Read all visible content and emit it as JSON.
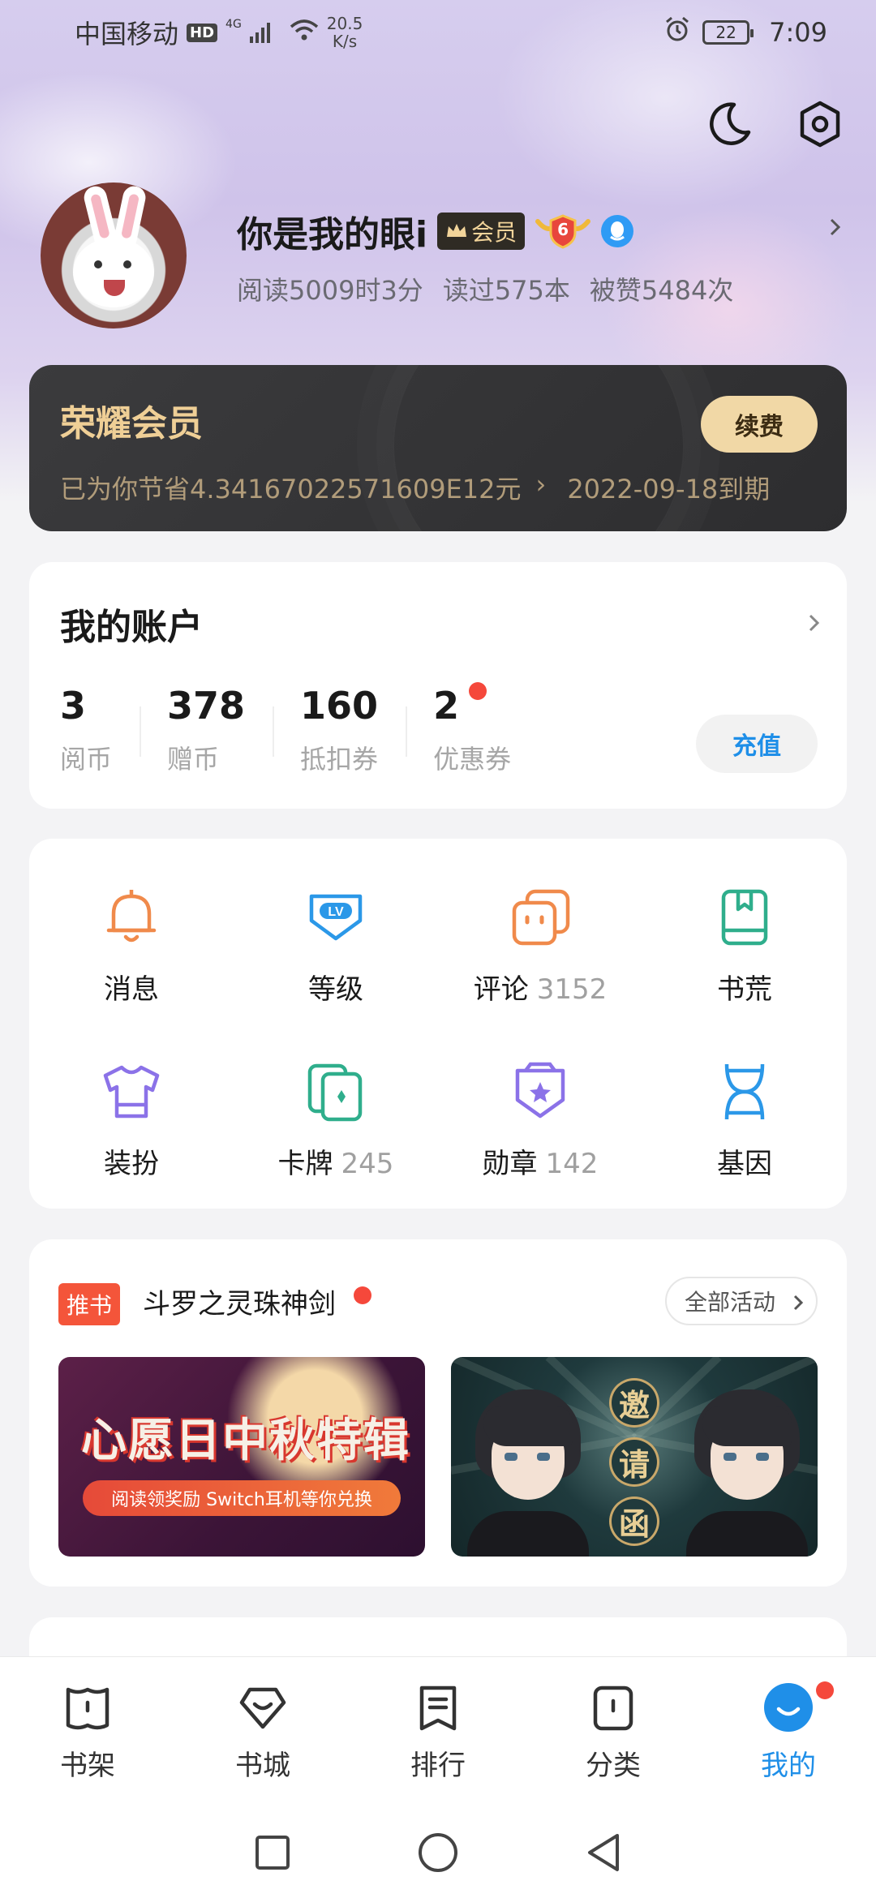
{
  "status_bar": {
    "carrier": "中国移动",
    "hd": "HD",
    "network": "4G",
    "speed_value": "20.5",
    "speed_unit": "K/s",
    "battery": "22",
    "time": "7:09"
  },
  "profile": {
    "username": "你是我的眼i",
    "vip_badge": "会员",
    "level": "6",
    "stats": [
      "阅读5009时3分",
      "读过575本",
      "被赞5484次"
    ]
  },
  "vip_card": {
    "title": "荣耀会员",
    "renew_label": "续费",
    "saved_text": "已为你节省4.34167022571609E12元",
    "arrow": "›",
    "expire_text": "2022-09-18到期"
  },
  "account": {
    "title": "我的账户",
    "stats": [
      {
        "value": "3",
        "label": "阅币"
      },
      {
        "value": "378",
        "label": "赠币"
      },
      {
        "value": "160",
        "label": "抵扣券"
      },
      {
        "value": "2",
        "label": "优惠券"
      }
    ],
    "recharge_label": "充值"
  },
  "grid": {
    "items": [
      {
        "label": "消息",
        "count": "",
        "icon": "bell-icon",
        "color": "#f08a4b"
      },
      {
        "label": "等级",
        "count": "",
        "icon": "level-icon",
        "color": "#2b98e8"
      },
      {
        "label": "评论",
        "count": "3152",
        "icon": "comment-icon",
        "color": "#f08a4b"
      },
      {
        "label": "书荒",
        "count": "",
        "icon": "book-icon",
        "color": "#2fae8c"
      },
      {
        "label": "装扮",
        "count": "",
        "icon": "shirt-icon",
        "color": "#8b72e8"
      },
      {
        "label": "卡牌",
        "count": "245",
        "icon": "cards-icon",
        "color": "#2fae8c"
      },
      {
        "label": "勋章",
        "count": "142",
        "icon": "medal-icon",
        "color": "#8b72e8"
      },
      {
        "label": "基因",
        "count": "",
        "icon": "dna-icon",
        "color": "#2b98e8"
      }
    ]
  },
  "recommend": {
    "tag": "推书",
    "title": "斗罗之灵珠神剑",
    "all_activities": "全部活动",
    "banner1_title": "心愿日中秋特辑",
    "banner1_sub": "阅读领奖励 Switch耳机等你兑换",
    "banner2_chars": [
      "邀",
      "请",
      "函"
    ]
  },
  "tab_bar": {
    "tabs": [
      {
        "label": "书架",
        "icon": "bookshelf-icon"
      },
      {
        "label": "书城",
        "icon": "bookstore-icon"
      },
      {
        "label": "排行",
        "icon": "ranking-icon"
      },
      {
        "label": "分类",
        "icon": "category-icon"
      },
      {
        "label": "我的",
        "icon": "profile-tab-icon"
      }
    ],
    "active_index": 4,
    "accent": "#1f8fe8"
  }
}
